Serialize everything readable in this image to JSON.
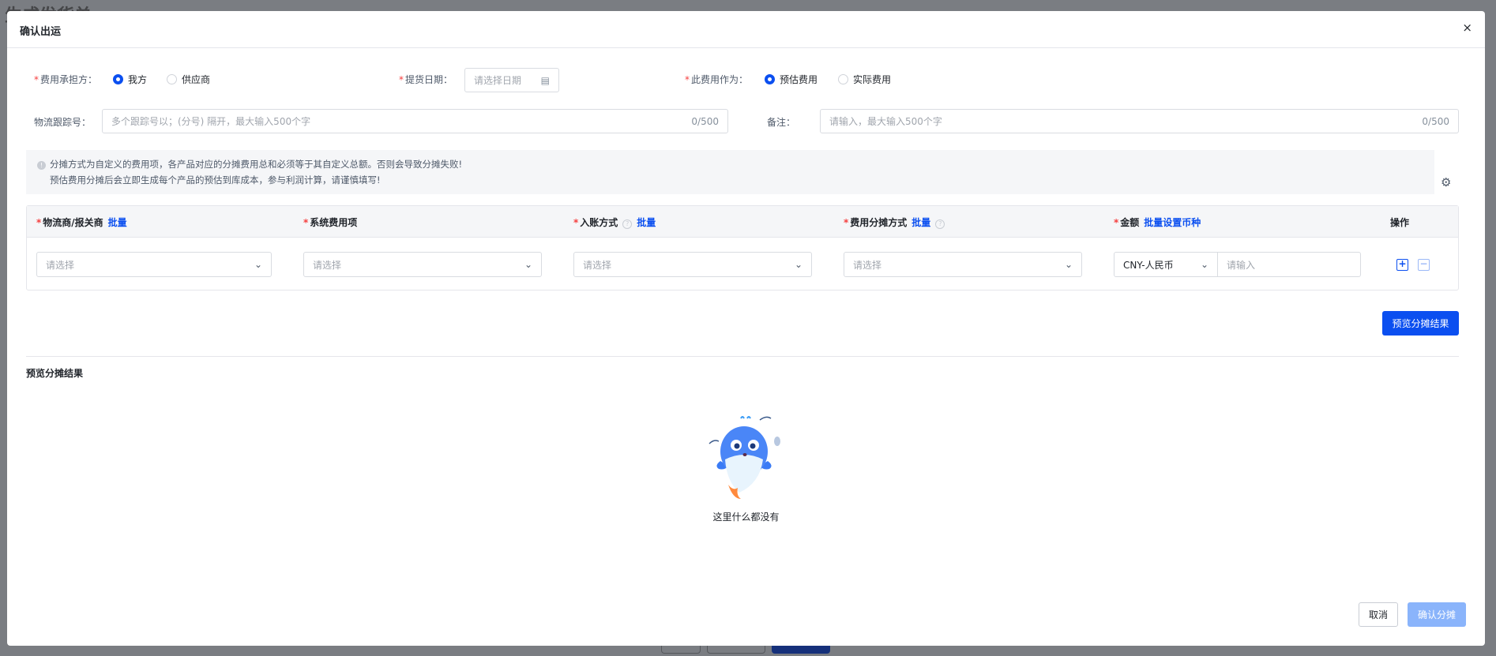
{
  "background": {
    "page_title": "生成发货单"
  },
  "modal": {
    "title": "确认出运",
    "close": "×"
  },
  "form": {
    "bearer": {
      "label": "费用承担方：",
      "options": [
        "我方",
        "供应商"
      ],
      "selected": "我方"
    },
    "pickup_date": {
      "label": "提货日期：",
      "placeholder": "请选择日期"
    },
    "cost_as": {
      "label": "此费用作为：",
      "options": [
        "预估费用",
        "实际费用"
      ],
      "selected": "预估费用"
    },
    "tracking": {
      "label": "物流跟踪号：",
      "placeholder": "多个跟踪号以；(分号) 隔开，最大输入500个字",
      "count": "0/500"
    },
    "remark": {
      "label": "备注：",
      "placeholder": "请输入，最大输入500个字",
      "count": "0/500"
    }
  },
  "notice": {
    "line1": "分摊方式为自定义的费用项，各产品对应的分摊费用总和必须等于其自定义总额。否则会导致分摊失败!",
    "line2": "预估费用分摊后会立即生成每个产品的预估到库成本，参与利润计算，请谨慎填写!"
  },
  "table": {
    "columns": [
      {
        "label": "物流商/报关商",
        "link": "批量"
      },
      {
        "label": "系统费用项"
      },
      {
        "label": "入账方式",
        "link": "批量"
      },
      {
        "label": "费用分摊方式",
        "link": "批量"
      },
      {
        "label": "金额",
        "link": "批量设置币种"
      },
      {
        "label": "操作"
      }
    ],
    "row": {
      "select_placeholder": "请选择",
      "currency": "CNY-人民币",
      "amount_placeholder": "请输入",
      "add": "+",
      "remove": "−"
    }
  },
  "preview_button": "预览分摊结果",
  "result": {
    "title": "预览分摊结果",
    "empty_text": "这里什么都没有"
  },
  "footer": {
    "cancel": "取消",
    "confirm": "确认分摊"
  }
}
